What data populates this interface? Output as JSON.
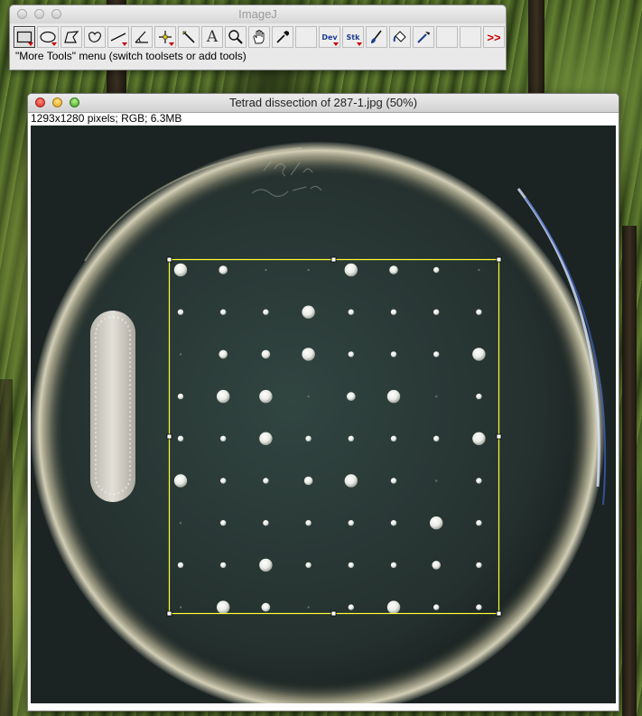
{
  "imagej": {
    "title": "ImageJ",
    "status": "\"More Tools\" menu (switch toolsets or add tools)",
    "tools": [
      {
        "icon": "rectangle-selection-icon",
        "selected": true,
        "dropdown": true
      },
      {
        "icon": "oval-selection-icon",
        "dropdown": true
      },
      {
        "icon": "polygon-selection-icon"
      },
      {
        "icon": "freehand-selection-icon"
      },
      {
        "icon": "line-selection-icon",
        "dropdown": true
      },
      {
        "icon": "angle-tool-icon"
      },
      {
        "icon": "point-tool-icon",
        "dropdown": true
      },
      {
        "icon": "wand-tool-icon"
      },
      {
        "icon": "text-tool-icon",
        "label": "A"
      },
      {
        "icon": "magnifying-glass-icon"
      },
      {
        "icon": "hand-scroll-icon"
      },
      {
        "icon": "color-picker-icon"
      },
      {
        "icon": "empty-slot"
      },
      {
        "icon": "dev-menu-icon",
        "label": "Dev",
        "dropdown": true
      },
      {
        "icon": "stack-menu-icon",
        "label": "Stk",
        "dropdown": true
      },
      {
        "icon": "brush-tool-icon"
      },
      {
        "icon": "flood-fill-icon"
      },
      {
        "icon": "pipette-tool-icon"
      },
      {
        "icon": "empty-slot"
      },
      {
        "icon": "empty-slot"
      },
      {
        "icon": "more-tools-icon",
        "label": ">>"
      }
    ]
  },
  "image_window": {
    "title": "Tetrad dissection of 287-1.jpg (50%)",
    "info": "1293x1280 pixels; RGB; 6.3MB",
    "plate_handwriting": "3/5 287-1",
    "colony_grid": {
      "rows": 9,
      "cols": 8,
      "sizes": [
        [
          3,
          2,
          0,
          0,
          3,
          2,
          1,
          0
        ],
        [
          1,
          1,
          1,
          3,
          1,
          1,
          1,
          1
        ],
        [
          0,
          2,
          2,
          3,
          1,
          1,
          1,
          3
        ],
        [
          1,
          3,
          3,
          0,
          2,
          3,
          0,
          1
        ],
        [
          1,
          1,
          3,
          1,
          1,
          1,
          1,
          3
        ],
        [
          3,
          1,
          1,
          2,
          3,
          1,
          0,
          1
        ],
        [
          0,
          1,
          1,
          1,
          1,
          1,
          3,
          1
        ],
        [
          1,
          1,
          3,
          1,
          1,
          1,
          2,
          1
        ],
        [
          0,
          3,
          2,
          0,
          1,
          3,
          1,
          1
        ]
      ]
    },
    "colors": {
      "selection": "#ffff33",
      "plate_background": "#2b3735",
      "colony": "#f2f4ef",
      "streak": "#d9d7cf"
    }
  }
}
